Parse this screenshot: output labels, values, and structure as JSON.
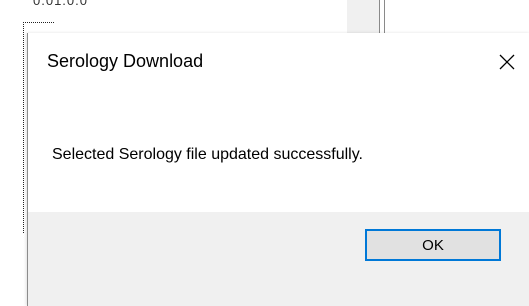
{
  "background": {
    "clipped_text": "0.01.0.0"
  },
  "dialog": {
    "title": "Serology Download",
    "message": "Selected Serology file updated successfully.",
    "ok_label": "OK",
    "close_icon": "close-icon"
  },
  "colors": {
    "footer_bg": "#f0f0f0",
    "button_bg": "#e1e1e1",
    "button_focus_border": "#0078d7"
  }
}
